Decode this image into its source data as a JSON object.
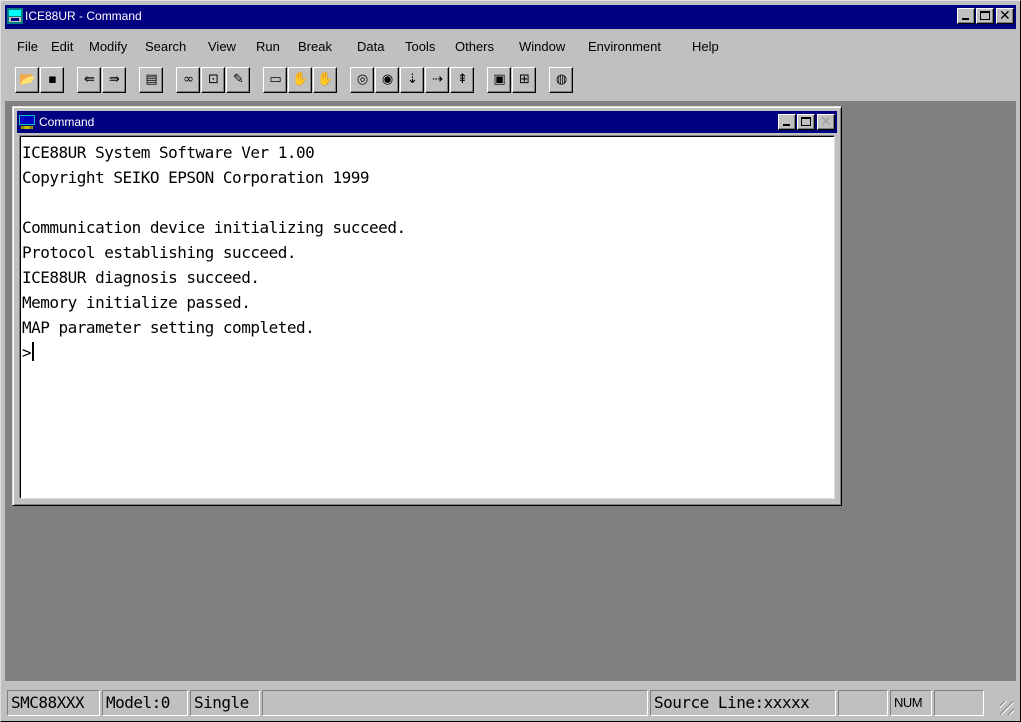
{
  "app": {
    "title": "ICE88UR - Command",
    "icon": "ice88-app-icon"
  },
  "menu": [
    {
      "label": "File"
    },
    {
      "label": "Edit"
    },
    {
      "label": "Modify"
    },
    {
      "label": "Search"
    },
    {
      "label": "View"
    },
    {
      "label": "Run"
    },
    {
      "label": "Break"
    },
    {
      "label": "Data"
    },
    {
      "label": "Tools"
    },
    {
      "label": "Others"
    },
    {
      "label": "Window"
    },
    {
      "label": "Environment"
    },
    {
      "label": "Help"
    }
  ],
  "toolbar": {
    "buttons": [
      {
        "icon": "open-folder-icon",
        "glyph": "📂"
      },
      {
        "icon": "save-disk-icon",
        "glyph": "▪"
      },
      {
        "icon": "load-program-icon",
        "glyph": "⇚"
      },
      {
        "icon": "load-option-icon",
        "glyph": "⇛"
      },
      {
        "icon": "source-file-icon",
        "glyph": "▤"
      },
      {
        "icon": "find-binoculars-icon",
        "glyph": "∞"
      },
      {
        "icon": "find-next-icon",
        "glyph": "⊡"
      },
      {
        "icon": "edit-pencil-icon",
        "glyph": "✎"
      },
      {
        "icon": "register-window-icon",
        "glyph": "▭"
      },
      {
        "icon": "stop-hand-icon",
        "glyph": "✋"
      },
      {
        "icon": "go-hand-disabled-icon",
        "glyph": "✋",
        "disabled": true
      },
      {
        "icon": "go-icon",
        "glyph": "◎"
      },
      {
        "icon": "go-to-icon",
        "glyph": "◉"
      },
      {
        "icon": "step-icon",
        "glyph": "⇣"
      },
      {
        "icon": "next-icon",
        "glyph": "⇢"
      },
      {
        "icon": "reset-icon",
        "glyph": "⇞"
      },
      {
        "icon": "breakpoint-icon",
        "glyph": "▣"
      },
      {
        "icon": "trace-icon",
        "glyph": "⊞"
      },
      {
        "icon": "help-icon",
        "glyph": "◍"
      }
    ]
  },
  "command_window": {
    "title": "Command",
    "icon": "command-window-icon",
    "lines": [
      "ICE88UR System Software Ver 1.00",
      "Copyright SEIKO EPSON Corporation 1999",
      "",
      "Communication device initializing succeed.",
      "Protocol establishing succeed.",
      "ICE88UR diagnosis succeed.",
      "Memory initialize passed.",
      "MAP parameter setting completed."
    ],
    "prompt": ">"
  },
  "status": {
    "chip": "SMC88XXX",
    "model": "Model:0",
    "mode": "Single",
    "message": "",
    "source_line": "Source Line:xxxxx",
    "col": "",
    "num": "NUM",
    "extra": ""
  }
}
